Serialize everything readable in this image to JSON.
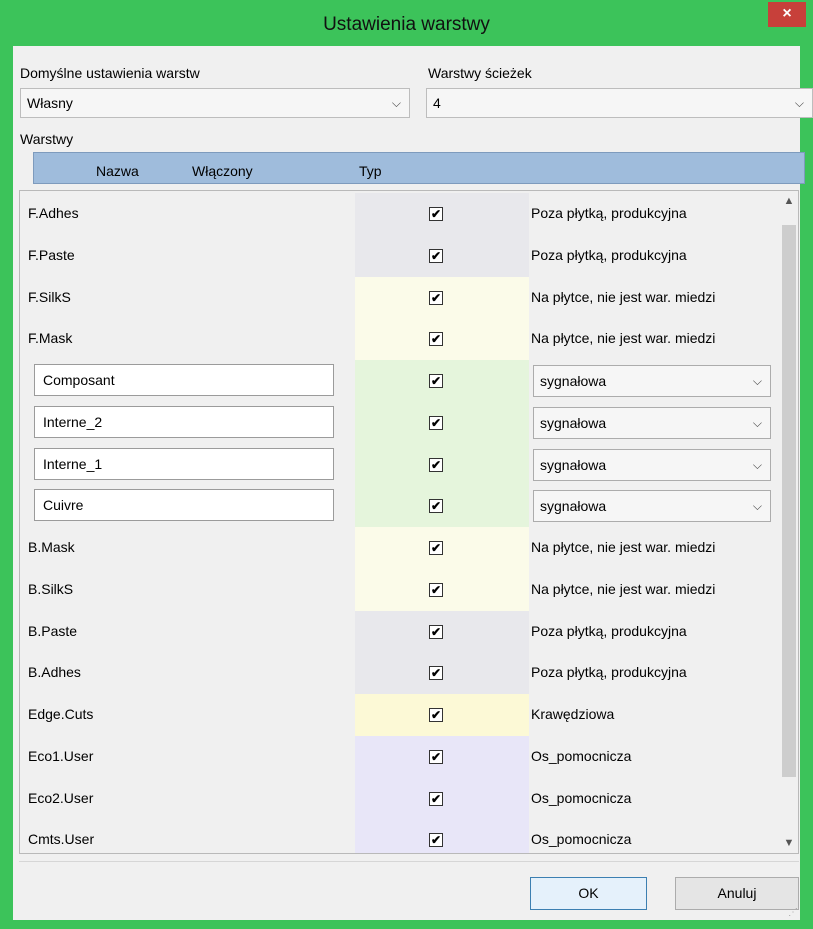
{
  "window": {
    "title": "Ustawienia warstwy",
    "close_label": "×"
  },
  "presets": {
    "label": "Domyślne ustawienia warstw",
    "value": "Własny"
  },
  "copper_layers": {
    "label": "Warstwy ścieżek",
    "value": "4"
  },
  "layers_label": "Warstwy",
  "columns": {
    "name": "Nazwa",
    "enabled": "Włączony",
    "type": "Typ"
  },
  "rows": [
    {
      "name": "F.Adhes",
      "editable": false,
      "enabled": true,
      "type": "Poza płytką, produkcyjna",
      "color": "#e8e8ec"
    },
    {
      "name": "F.Paste",
      "editable": false,
      "enabled": true,
      "type": "Poza płytką, produkcyjna",
      "color": "#e8e8ec"
    },
    {
      "name": "F.SilkS",
      "editable": false,
      "enabled": true,
      "type": "Na płytce, nie jest war. miedzi",
      "color": "#fbfbe9"
    },
    {
      "name": "F.Mask",
      "editable": false,
      "enabled": true,
      "type": "Na płytce, nie jest war. miedzi",
      "color": "#fbfbe9"
    },
    {
      "name": "Composant",
      "editable": true,
      "enabled": true,
      "type": "sygnałowa",
      "color": "#e5f5dc"
    },
    {
      "name": "Interne_2",
      "editable": true,
      "enabled": true,
      "type": "sygnałowa",
      "color": "#e5f5dc"
    },
    {
      "name": "Interne_1",
      "editable": true,
      "enabled": true,
      "type": "sygnałowa",
      "color": "#e5f5dc"
    },
    {
      "name": "Cuivre",
      "editable": true,
      "enabled": true,
      "type": "sygnałowa",
      "color": "#e5f5dc"
    },
    {
      "name": "B.Mask",
      "editable": false,
      "enabled": true,
      "type": "Na płytce, nie jest war. miedzi",
      "color": "#fbfbe9"
    },
    {
      "name": "B.SilkS",
      "editable": false,
      "enabled": true,
      "type": "Na płytce, nie jest war. miedzi",
      "color": "#fbfbe9"
    },
    {
      "name": "B.Paste",
      "editable": false,
      "enabled": true,
      "type": "Poza płytką, produkcyjna",
      "color": "#e8e8ec"
    },
    {
      "name": "B.Adhes",
      "editable": false,
      "enabled": true,
      "type": "Poza płytką, produkcyjna",
      "color": "#e8e8ec"
    },
    {
      "name": "Edge.Cuts",
      "editable": false,
      "enabled": true,
      "type": "Krawędziowa",
      "color": "#fcf9d6"
    },
    {
      "name": "Eco1.User",
      "editable": false,
      "enabled": true,
      "type": "Os_pomocnicza",
      "color": "#e8e6f8"
    },
    {
      "name": "Eco2.User",
      "editable": false,
      "enabled": true,
      "type": "Os_pomocnicza",
      "color": "#e8e6f8"
    },
    {
      "name": "Cmts.User",
      "editable": false,
      "enabled": true,
      "type": "Os_pomocnicza",
      "color": "#e8e6f8"
    }
  ],
  "buttons": {
    "ok": "OK",
    "cancel": "Anuluj"
  },
  "colors": {
    "frame": "#3cc35a",
    "header": "#9fbcdc",
    "close": "#c7403a"
  }
}
